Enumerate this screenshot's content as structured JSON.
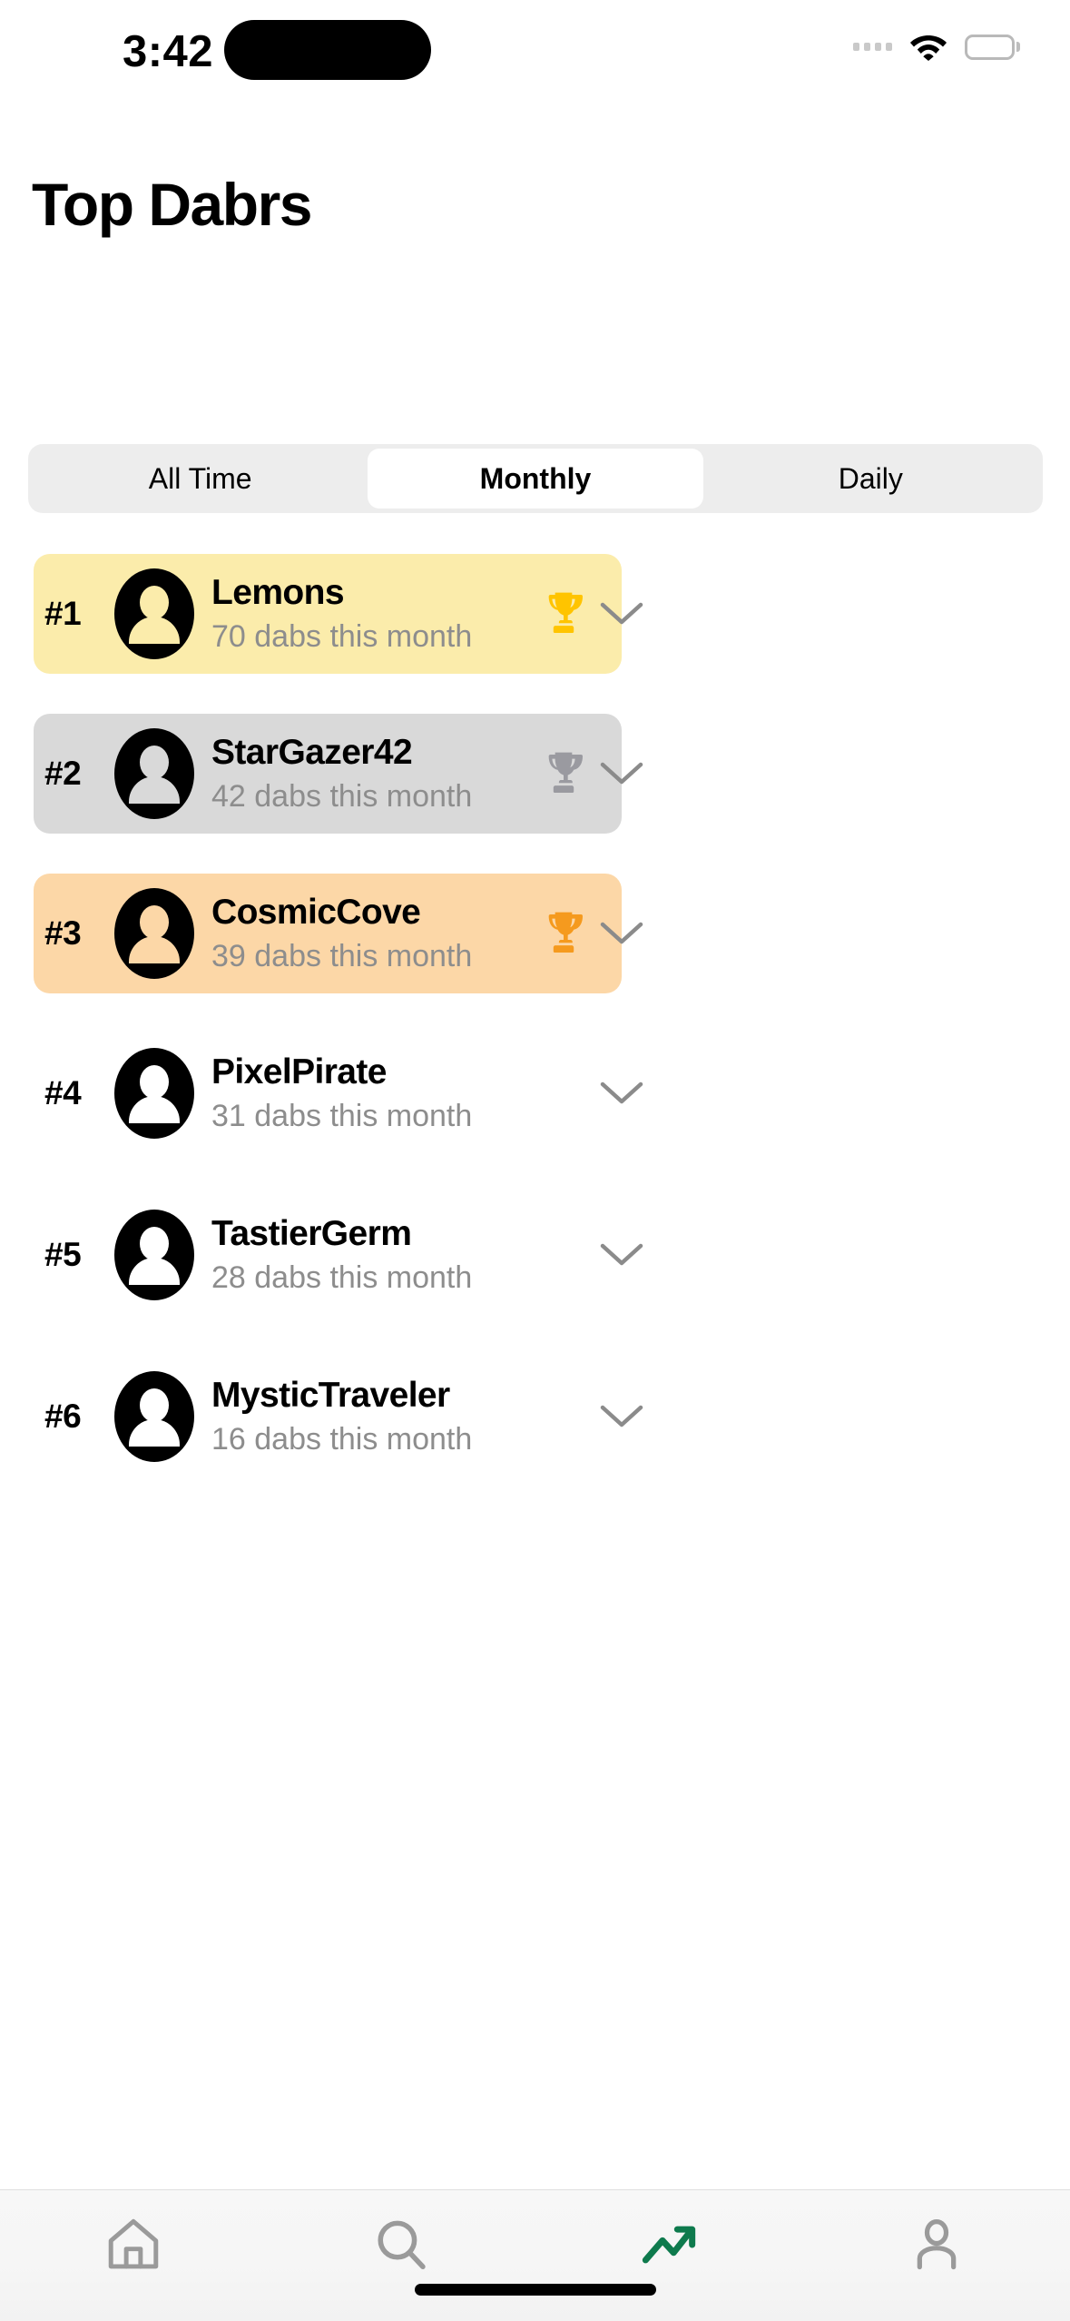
{
  "status_bar": {
    "time": "3:42",
    "cellular_icon": "cellular-dots-icon",
    "wifi_icon": "wifi-icon",
    "battery_icon": "battery-icon"
  },
  "header": {
    "title": "Top Dabrs"
  },
  "segmented_control": {
    "selected": "Monthly",
    "options": [
      {
        "label": "All Time",
        "active": false
      },
      {
        "label": "Monthly",
        "active": true
      },
      {
        "label": "Daily",
        "active": false
      }
    ]
  },
  "leaderboard": {
    "rows": [
      {
        "rank": "#1",
        "username": "Lemons",
        "subtitle": "70 dabs this month",
        "card": "gold",
        "bg": "#FBECAB",
        "trophy": "trophy-icon",
        "trophy_color": "#FFC400",
        "chevron": "chevron-down-icon"
      },
      {
        "rank": "#2",
        "username": "StarGazer42",
        "subtitle": "42 dabs this month",
        "card": "silver",
        "bg": "#D9D9D9",
        "trophy": "trophy-icon",
        "trophy_color": "#9A9AA0",
        "chevron": "chevron-down-icon"
      },
      {
        "rank": "#3",
        "username": "CosmicCove",
        "subtitle": "39 dabs this month",
        "card": "bronze",
        "bg": "#FCD7A7",
        "trophy": "trophy-icon",
        "trophy_color": "#F59A1E",
        "chevron": "chevron-down-icon"
      },
      {
        "rank": "#4",
        "username": "PixelPirate",
        "subtitle": "31 dabs this month",
        "card": "none",
        "bg": "#FFFFFF",
        "trophy": null,
        "trophy_color": null,
        "chevron": "chevron-down-icon"
      },
      {
        "rank": "#5",
        "username": "TastierGerm",
        "subtitle": "28 dabs this month",
        "card": "none",
        "bg": "#FFFFFF",
        "trophy": null,
        "trophy_color": null,
        "chevron": "chevron-down-icon"
      },
      {
        "rank": "#6",
        "username": "MysticTraveler",
        "subtitle": "16 dabs this month",
        "card": "none",
        "bg": "#FFFFFF",
        "trophy": null,
        "trophy_color": null,
        "chevron": "chevron-down-icon"
      }
    ]
  },
  "tabbar": {
    "active_index": 2,
    "active_color": "#0E7A4D",
    "inactive_color": "#9A9A9A",
    "items": [
      {
        "icon": "home-icon",
        "active": false
      },
      {
        "icon": "search-icon",
        "active": false
      },
      {
        "icon": "trending-up-icon",
        "active": true
      },
      {
        "icon": "profile-icon",
        "active": false
      }
    ]
  },
  "home_indicator": {
    "icon": "home-indicator-bar"
  }
}
